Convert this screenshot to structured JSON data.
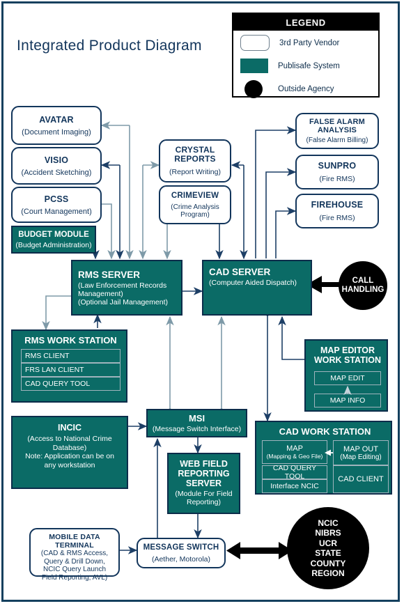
{
  "page": {
    "title": "Integrated Product Diagram"
  },
  "legend": {
    "heading": "LEGEND",
    "items": [
      {
        "swatch": "vendor-swatch",
        "label": "3rd Party Vendor",
        "color": "#ffffff"
      },
      {
        "swatch": "publisafe-swatch",
        "label": "Publisafe System",
        "color": "#0b6b66"
      },
      {
        "swatch": "outside-agency-swatch",
        "label": "Outside Agency",
        "color": "#000000"
      }
    ]
  },
  "nodes": {
    "avatar": {
      "title": "AVATAR",
      "sub": "(Document Imaging)",
      "type": "3rd Party Vendor"
    },
    "visio": {
      "title": "VISIO",
      "sub": "(Accident Sketching)",
      "type": "3rd Party Vendor"
    },
    "pcss": {
      "title": "PCSS",
      "sub": "(Court Management)",
      "type": "3rd Party Vendor"
    },
    "budget": {
      "title": "BUDGET MODULE",
      "sub": "(Budget Administration)",
      "type": "Publisafe System"
    },
    "crystal": {
      "title": "CRYSTAL REPORTS",
      "title_l1": "CRYSTAL",
      "title_l2": "REPORTS",
      "sub": "(Report Writing)",
      "type": "3rd Party Vendor"
    },
    "crimeview": {
      "title": "CRIMEVIEW",
      "sub_l1": "(Crime Analysis",
      "sub_l2": "Program)",
      "type": "3rd Party Vendor"
    },
    "false_alarm": {
      "title_l1": "FALSE ALARM",
      "title_l2": "ANALYSIS",
      "sub": "(False Alarm Billing)",
      "type": "3rd Party Vendor"
    },
    "sunpro": {
      "title": "SUNPRO",
      "sub": "(Fire RMS)",
      "type": "3rd Party Vendor"
    },
    "firehouse": {
      "title": "FIREHOUSE",
      "sub": "(Fire RMS)",
      "type": "3rd Party Vendor"
    },
    "rms_server": {
      "title": "RMS SERVER",
      "sub_l1": "(Law Enforcement Records",
      "sub_l2": "Management)",
      "sub_l3": "(Optional Jail Management)",
      "type": "Publisafe System"
    },
    "cad_server": {
      "title": "CAD SERVER",
      "sub": "(Computer Aided Dispatch)",
      "type": "Publisafe System"
    },
    "call_handling": {
      "title_l1": "CALL",
      "title_l2": "HANDLING",
      "type": "Outside Agency"
    },
    "rms_work_station": {
      "title": "RMS WORK STATION",
      "type": "Publisafe System",
      "items": [
        "RMS CLIENT",
        "FRS LAN CLIENT",
        "CAD QUERY TOOL"
      ]
    },
    "map_editor_work_station": {
      "title_l1": "MAP EDITOR",
      "title_l2": "WORK STATION",
      "type": "Publisafe System",
      "items": [
        "MAP EDIT",
        "MAP INFO"
      ]
    },
    "incic": {
      "title": "INCIC",
      "sub_l1": "(Access to National Crime",
      "sub_l2": "Database)",
      "sub_l3": "Note: Application can be on",
      "sub_l4": "any workstation",
      "type": "Publisafe System"
    },
    "msi": {
      "title": "MSI",
      "sub": "(Message Switch Interface)",
      "type": "Publisafe System"
    },
    "web_field": {
      "title_l1": "WEB FIELD",
      "title_l2": "REPORTING",
      "title_l3": "SERVER",
      "sub_l1": "(Module For Field",
      "sub_l2": "Reporting)",
      "type": "Publisafe System"
    },
    "cad_work_station": {
      "title": "CAD WORK STATION",
      "type": "Publisafe System",
      "map": {
        "l1": "MAP",
        "l2": "(Mapping & Geo File)"
      },
      "map_out": {
        "l1": "MAP OUT",
        "l2": "(Map Editing)"
      },
      "cad_query": {
        "l1": "CAD QUERY TOOL"
      },
      "interface": {
        "l1": "Interface NCIC"
      },
      "cad_client": {
        "l1": "CAD CLIENT"
      }
    },
    "mobile_data_terminal": {
      "title_l1": "MOBILE DATA",
      "title_l2": "TERMINAL",
      "sub_l1": "(CAD & RMS Access,",
      "sub_l2": "Query & Drill Down,",
      "sub_l3": "NCIC Query Launch",
      "sub_l4": "Field Reporting, AVL)",
      "type": "3rd Party Vendor"
    },
    "message_switch": {
      "title": "MESSAGE SWITCH",
      "sub": "(Aether, Motorola)",
      "type": "3rd Party Vendor"
    },
    "ncic_circle": {
      "type": "Outside Agency",
      "lines": [
        "NCIC",
        "NIBRS",
        "UCR",
        "STATE",
        "COUNTY",
        "REGION"
      ]
    }
  },
  "colors": {
    "publisafe_teal": "#0b6b66",
    "border_navy": "#12355b",
    "arrow_navy": "#1d3f66",
    "arrow_gray": "#7e9aa8",
    "outside_agency_black": "#000000",
    "page_background": "#ffffff"
  }
}
